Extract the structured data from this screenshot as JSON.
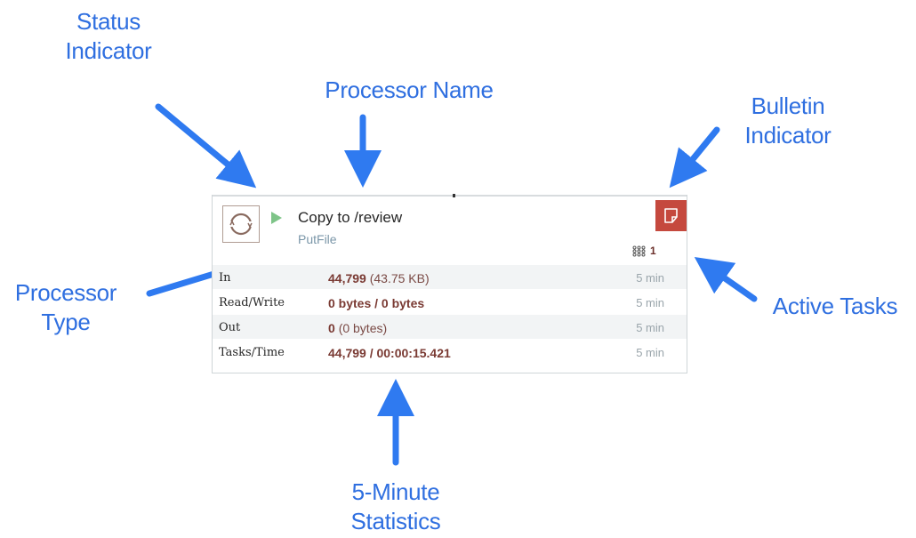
{
  "callouts": {
    "status": [
      "Status",
      "Indicator"
    ],
    "name": "Processor Name",
    "bulletin": [
      "Bulletin",
      "Indicator"
    ],
    "type": [
      "Processor",
      "Type"
    ],
    "active": "Active Tasks",
    "stats": [
      "5-Minute",
      "Statistics"
    ]
  },
  "processor": {
    "name": "Copy to /review",
    "type": "PutFile",
    "active_tasks": "1",
    "icons": {
      "type": "processor-icon",
      "status": "running-icon",
      "bulletin": "bulletin-icon",
      "tasks": "active-tasks-icon"
    },
    "stats": [
      {
        "label": "In",
        "value": "44,799",
        "extra": "(43.75 KB)",
        "window": "5 min"
      },
      {
        "label": "Read/Write",
        "value": "0 bytes / 0 bytes",
        "extra": "",
        "window": "5 min"
      },
      {
        "label": "Out",
        "value": "0",
        "extra": "(0 bytes)",
        "window": "5 min"
      },
      {
        "label": "Tasks/Time",
        "value": "44,799 / 00:00:15.421",
        "extra": "",
        "window": "5 min"
      }
    ]
  },
  "colors": {
    "callout": "#2f6fe0",
    "bulletin": "#c5493e",
    "running": "#7ec488"
  }
}
